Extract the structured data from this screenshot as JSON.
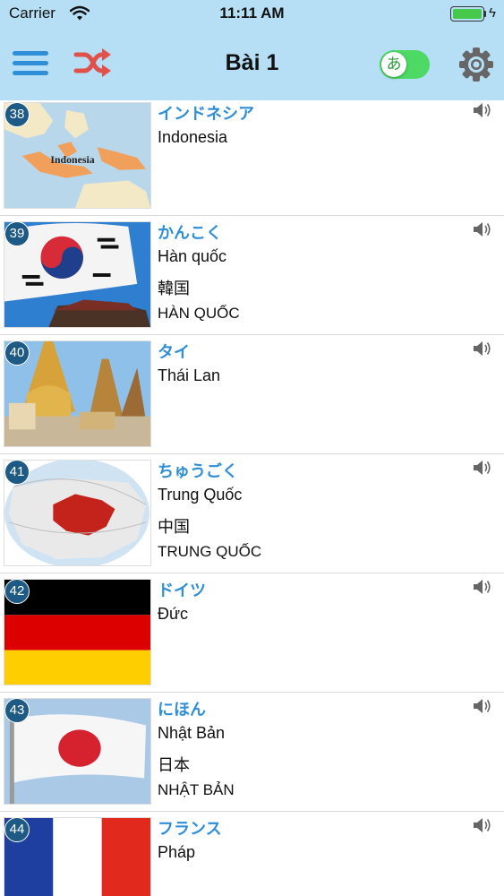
{
  "status_bar": {
    "carrier": "Carrier",
    "time": "11:11 AM",
    "battery_level": 1.0
  },
  "nav": {
    "title": "Bài 1",
    "toggle_glyph": "あ",
    "toggle_on": true,
    "accent_color": "#2f8ed8",
    "shuffle_color": "#e0514b"
  },
  "items": [
    {
      "num": "38",
      "kana": "インドネシア",
      "meaning": "Indonesia",
      "kanji": "",
      "hanviet": "",
      "image": "map-indonesia",
      "map_label": "Indonesia"
    },
    {
      "num": "39",
      "kana": "かんこく",
      "meaning": "Hàn quốc",
      "kanji": "韓国",
      "hanviet": "HÀN QUỐC",
      "image": "flag-korea"
    },
    {
      "num": "40",
      "kana": "タイ",
      "meaning": "Thái Lan",
      "kanji": "",
      "hanviet": "",
      "image": "temple-thailand"
    },
    {
      "num": "41",
      "kana": "ちゅうごく",
      "meaning": "Trung Quốc",
      "kanji": "中国",
      "hanviet": "TRUNG QUỐC",
      "image": "globe-china"
    },
    {
      "num": "42",
      "kana": "ドイツ",
      "meaning": "Đức",
      "kanji": "",
      "hanviet": "",
      "image": "flag-germany"
    },
    {
      "num": "43",
      "kana": "にほん",
      "meaning": "Nhật Bản",
      "kanji": "日本",
      "hanviet": "NHẬT BẢN",
      "image": "flag-japan"
    },
    {
      "num": "44",
      "kana": "フランス",
      "meaning": "Pháp",
      "kanji": "",
      "hanviet": "",
      "image": "flag-france"
    }
  ]
}
